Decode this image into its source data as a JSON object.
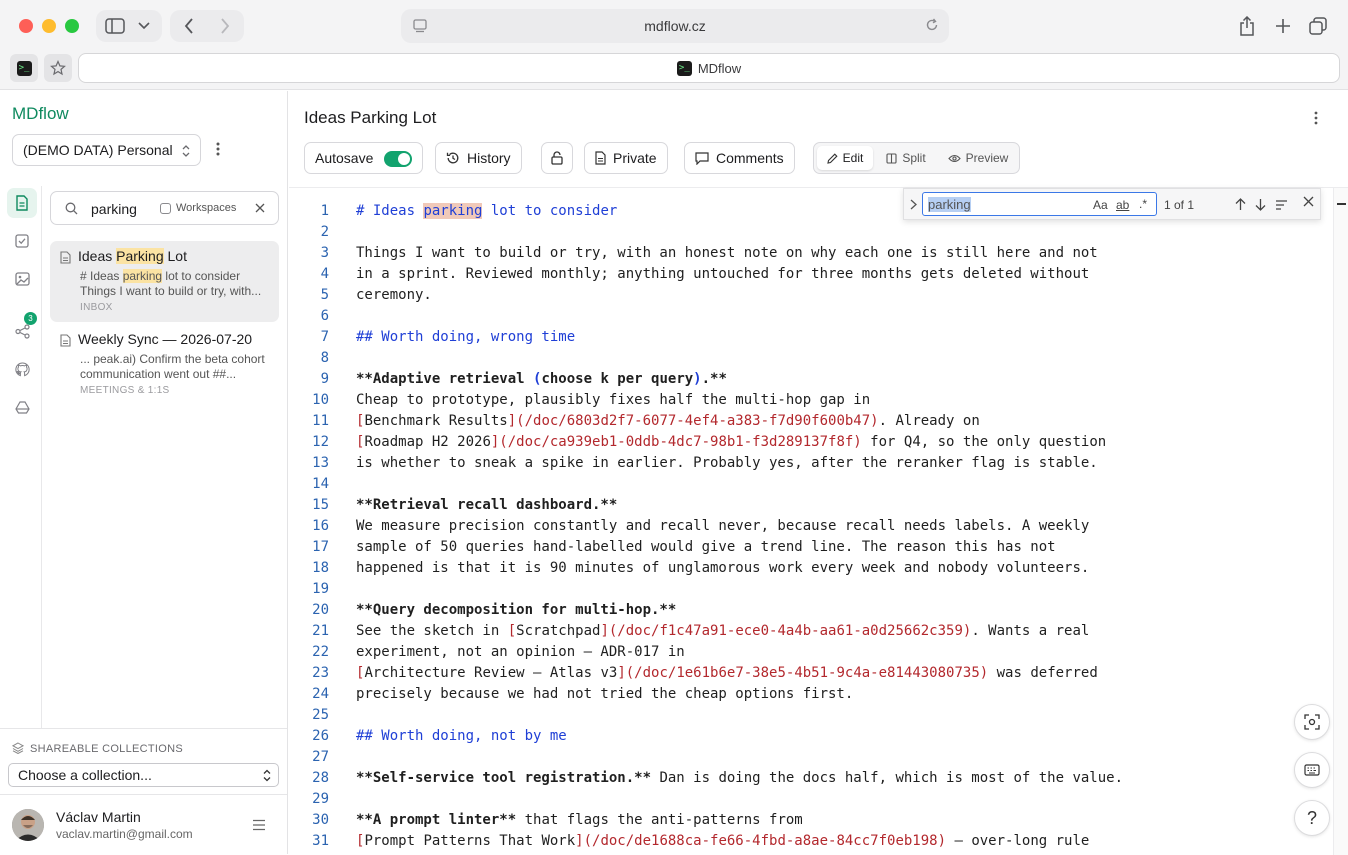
{
  "browser": {
    "url": "mdflow.cz",
    "tab_title": "MDflow",
    "favicon_glyph": ">_"
  },
  "sidebar": {
    "app_name": "MDflow",
    "workspace_select": "(DEMO DATA) Personal",
    "search_value": "parking",
    "workspaces_label": "Workspaces",
    "rail_badge": "3",
    "results": [
      {
        "title_pre": "Ideas ",
        "title_hit": "Parking",
        "title_post": " Lot",
        "snippet1_pre": "# Ideas ",
        "snippet1_hit": "parking",
        "snippet1_post": " lot to consider",
        "snippet2": "Things I want to build or try, with...",
        "tag": "INBOX"
      },
      {
        "title": "Weekly Sync — 2026-07-20",
        "snippet1": "... peak.ai) Confirm the beta cohort",
        "snippet2": "communication went out ##...",
        "tag": "MEETINGS & 1:1S"
      }
    ],
    "collections_heading": "SHAREABLE COLLECTIONS",
    "collections_select": "Choose a collection...",
    "user_name": "Václav Martin",
    "user_email": "vaclav.martin@gmail.com"
  },
  "main": {
    "doc_title": "Ideas Parking Lot",
    "toolbar": {
      "autosave": "Autosave",
      "history": "History",
      "private": "Private",
      "comments": "Comments",
      "edit": "Edit",
      "split": "Split",
      "preview": "Preview"
    },
    "find": {
      "query": "parking",
      "case_toggle": "Aa",
      "word_toggle": "ab",
      "regex_toggle": ".*",
      "count": "1 of 1"
    },
    "help_label": "?"
  },
  "editor": {
    "line_numbers": [
      "1",
      "2",
      "3",
      "4",
      "5",
      "6",
      "7",
      "8",
      "9",
      "10",
      "11",
      "12",
      "13",
      "14",
      "15",
      "16",
      "17",
      "18",
      "19",
      "20",
      "21",
      "22",
      "23",
      "24",
      "25",
      "26",
      "27",
      "28",
      "29",
      "30",
      "31"
    ],
    "l1a": "# Ideas ",
    "l1b": "parking",
    "l1c": " lot to consider",
    "l3": "Things I want to build or try, with an honest note on why each one is still here and not",
    "l4": "in a sprint. Reviewed monthly; anything untouched for three months gets deleted without",
    "l5": "ceremony.",
    "l7": "## Worth doing, wrong time",
    "l9a": "**Adaptive retrieval ",
    "l9b": "(",
    "l9c": "choose k per query",
    "l9d": ")",
    "l9e": ".**",
    "l10": "Cheap to prototype, plausibly fixes half the multi-hop gap in",
    "l11a": "[",
    "l11b": "Benchmark Results",
    "l11c": "](/doc/6803d2f7-6077-4ef4-a383-f7d90f600b47)",
    "l11d": ". Already on",
    "l12a": "[",
    "l12b": "Roadmap H2 2026",
    "l12c": "](/doc/ca939eb1-0ddb-4dc7-98b1-f3d289137f8f)",
    "l12d": " for Q4, so the only question",
    "l13": "is whether to sneak a spike in earlier. Probably yes, after the reranker flag is stable.",
    "l15": "**Retrieval recall dashboard.**",
    "l16": "We measure precision constantly and recall never, because recall needs labels. A weekly",
    "l17": "sample of 50 queries hand-labelled would give a trend line. The reason this has not",
    "l18": "happened is that it is 90 minutes of unglamorous work every week and nobody volunteers.",
    "l20": "**Query decomposition for multi-hop.**",
    "l21a": "See the sketch in ",
    "l21b": "[",
    "l21c": "Scratchpad",
    "l21d": "](/doc/f1c47a91-ece0-4a4b-aa61-a0d25662c359)",
    "l21e": ". Wants a real",
    "l22": "experiment, not an opinion — ADR-017 in",
    "l23a": "[",
    "l23b": "Architecture Review — Atlas v3",
    "l23c": "](/doc/1e61b6e7-38e5-4b51-9c4a-e81443080735)",
    "l23d": " was deferred",
    "l24": "precisely because we had not tried the cheap options first.",
    "l26": "## Worth doing, not by me",
    "l28a": "**Self-service tool registration.**",
    "l28b": " Dan is doing the docs half, which is most of the value.",
    "l30a": "**A prompt linter**",
    "l30b": " that flags the anti-patterns from",
    "l31a": "[",
    "l31b": "Prompt Patterns That Work",
    "l31c": "](/doc/de1688ca-fe66-4fbd-a8ae-84cc7f0eb198)",
    "l31d": " — over-long rule"
  }
}
